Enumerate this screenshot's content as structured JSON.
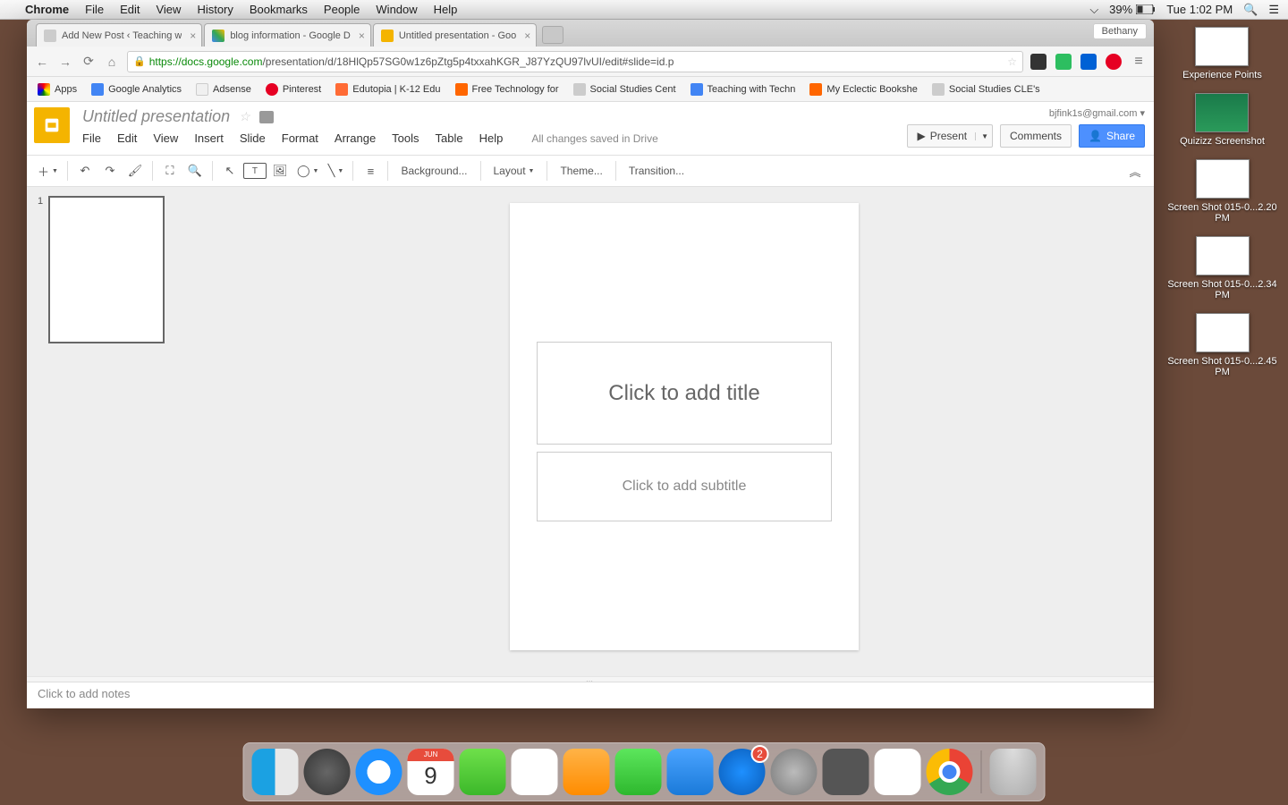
{
  "mac_menu": {
    "app": "Chrome",
    "items": [
      "File",
      "Edit",
      "View",
      "History",
      "Bookmarks",
      "People",
      "Window",
      "Help"
    ],
    "battery": "39%",
    "time": "Tue 1:02 PM"
  },
  "chrome": {
    "tabs": [
      {
        "title": "Add New Post ‹ Teaching w",
        "fav": "wp"
      },
      {
        "title": "blog information - Google D",
        "fav": "drive"
      },
      {
        "title": "Untitled presentation - Goo",
        "fav": "slides"
      }
    ],
    "profile": "Bethany",
    "url_secure": "https",
    "url_host": "://docs.google.com",
    "url_path": "/presentation/d/18HlQp57SG0w1z6pZtg5p4txxahKGR_J87YzQU97lvUI/edit#slide=id.p",
    "bookmarks": [
      {
        "label": "Apps",
        "fav": "apps"
      },
      {
        "label": "Google Analytics",
        "fav": "ga"
      },
      {
        "label": "Adsense",
        "fav": "ad"
      },
      {
        "label": "Pinterest",
        "fav": "pin"
      },
      {
        "label": "Edutopia | K-12 Edu",
        "fav": "edu"
      },
      {
        "label": "Free Technology for",
        "fav": "blg"
      },
      {
        "label": "Social Studies Cent",
        "fav": "ss"
      },
      {
        "label": "Teaching with Techn",
        "fav": "g"
      },
      {
        "label": "My Eclectic Bookshe",
        "fav": "blg"
      },
      {
        "label": "Social Studies CLE's",
        "fav": "doc"
      }
    ]
  },
  "slides": {
    "doc_title": "Untitled presentation",
    "email": "bjfink1s@gmail.com",
    "menus": [
      "File",
      "Edit",
      "View",
      "Insert",
      "Slide",
      "Format",
      "Arrange",
      "Tools",
      "Table",
      "Help"
    ],
    "saved": "All changes saved in Drive",
    "present_label": "Present",
    "comments_label": "Comments",
    "share_label": "Share",
    "toolbar_text": {
      "background": "Background...",
      "layout": "Layout",
      "theme": "Theme...",
      "transition": "Transition..."
    },
    "thumb_num": "1",
    "title_placeholder": "Click to add title",
    "subtitle_placeholder": "Click to add subtitle",
    "notes_placeholder": "Click to add notes"
  },
  "desktop_icons": [
    {
      "label": "Experience Points",
      "thumb": "white"
    },
    {
      "label": "Quizizz Screenshot",
      "thumb": "green"
    },
    {
      "label": "Screen Shot 015-0...2.20 PM",
      "thumb": "white"
    },
    {
      "label": "Screen Shot 015-0...2.34 PM",
      "thumb": "white"
    },
    {
      "label": "Screen Shot 015-0...2.45 PM",
      "thumb": "white"
    }
  ],
  "dock": {
    "cal_month": "JUN",
    "cal_day": "9",
    "appstore_badge": "2"
  }
}
